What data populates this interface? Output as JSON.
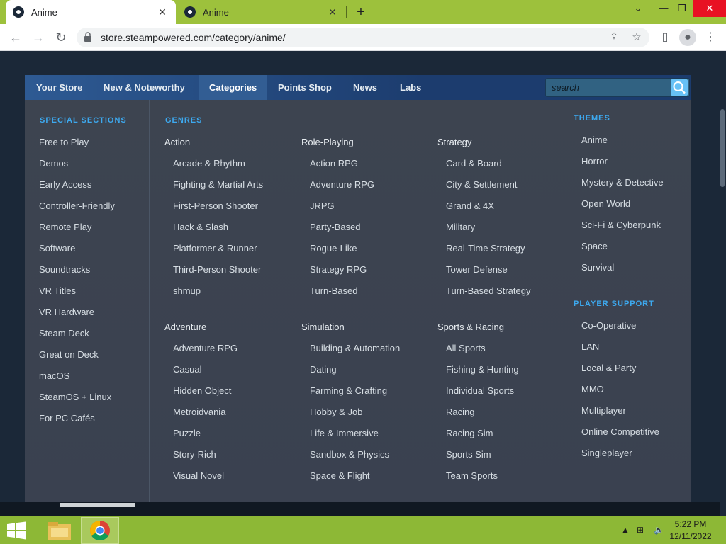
{
  "browser": {
    "tabs": [
      {
        "title": "Anime",
        "active": true
      },
      {
        "title": "Anime",
        "active": false
      }
    ],
    "new_tab": "+",
    "url": "store.steampowered.com/category/anime/"
  },
  "nav": {
    "items": [
      "Your Store",
      "New & Noteworthy",
      "Categories",
      "Points Shop",
      "News",
      "Labs"
    ],
    "active_index": 2,
    "search_placeholder": "search"
  },
  "special_sections": {
    "title": "SPECIAL SECTIONS",
    "items": [
      "Free to Play",
      "Demos",
      "Early Access",
      "Controller-Friendly",
      "Remote Play",
      "Software",
      "Soundtracks",
      "VR Titles",
      "VR Hardware",
      "Steam Deck",
      "Great on Deck",
      "macOS",
      "SteamOS + Linux",
      "For PC Cafés"
    ]
  },
  "genres": {
    "title": "GENRES",
    "groups": [
      {
        "name": "Action",
        "items": [
          "Arcade & Rhythm",
          "Fighting & Martial Arts",
          "First-Person Shooter",
          "Hack & Slash",
          "Platformer & Runner",
          "Third-Person Shooter",
          "shmup"
        ]
      },
      {
        "name": "Role-Playing",
        "items": [
          "Action RPG",
          "Adventure RPG",
          "JRPG",
          "Party-Based",
          "Rogue-Like",
          "Strategy RPG",
          "Turn-Based"
        ]
      },
      {
        "name": "Strategy",
        "items": [
          "Card & Board",
          "City & Settlement",
          "Grand & 4X",
          "Military",
          "Real-Time Strategy",
          "Tower Defense",
          "Turn-Based Strategy"
        ]
      },
      {
        "name": "Adventure",
        "items": [
          "Adventure RPG",
          "Casual",
          "Hidden Object",
          "Metroidvania",
          "Puzzle",
          "Story-Rich",
          "Visual Novel"
        ]
      },
      {
        "name": "Simulation",
        "items": [
          "Building & Automation",
          "Dating",
          "Farming & Crafting",
          "Hobby & Job",
          "Life & Immersive",
          "Sandbox & Physics",
          "Space & Flight"
        ]
      },
      {
        "name": "Sports & Racing",
        "items": [
          "All Sports",
          "Fishing & Hunting",
          "Individual Sports",
          "Racing",
          "Racing Sim",
          "Sports Sim",
          "Team Sports"
        ]
      }
    ]
  },
  "themes": {
    "title": "THEMES",
    "items": [
      "Anime",
      "Horror",
      "Mystery & Detective",
      "Open World",
      "Sci-Fi & Cyberpunk",
      "Space",
      "Survival"
    ]
  },
  "player_support": {
    "title": "PLAYER SUPPORT",
    "items": [
      "Co-Operative",
      "LAN",
      "Local & Party",
      "MMO",
      "Multiplayer",
      "Online Competitive",
      "Singleplayer"
    ]
  },
  "taskbar": {
    "time": "5:22 PM",
    "date": "12/11/2022"
  },
  "colors": {
    "tabstrip": "#9dc13c",
    "steam_bg": "#1b2838",
    "section_title": "#3da9ef",
    "taskbar": "#8db836"
  }
}
